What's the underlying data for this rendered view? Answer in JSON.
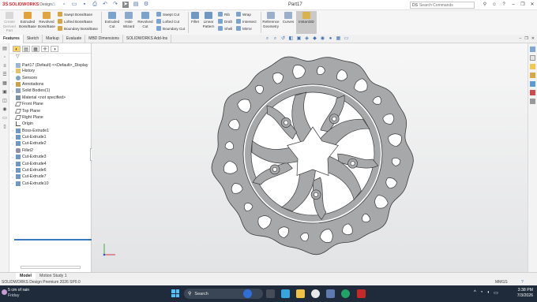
{
  "titlebar": {
    "brand_ds": "3S",
    "brand_sw": "SOLIDWORKS",
    "brand_design": "Design",
    "document": "Part17",
    "search_placeholder": "Search Commands",
    "search_brand": "DS"
  },
  "ribbon": {
    "create_derived": "Create Derived Part",
    "extruded_boss": "Extruded Boss/Base",
    "revolved_boss": "Revolved Boss/Base",
    "swept_boss": "Swept Boss/Base",
    "lofted_boss": "Lofted Boss/Base",
    "boundary_boss": "Boundary Boss/Base",
    "extruded_cut": "Extruded Cut",
    "hole_wizard": "Hole Wizard",
    "revolved_cut": "Revolved Cut",
    "swept_cut": "Swept Cut",
    "lofted_cut": "Lofted Cut",
    "boundary_cut": "Boundary Cut",
    "fillet": "Fillet",
    "linear_pattern": "Linear Pattern",
    "rib": "Rib",
    "draft": "Draft",
    "shell": "Shell",
    "wrap": "Wrap",
    "intersect": "Intersect",
    "mirror": "Mirror",
    "reference_geometry": "Reference Geometry",
    "curves": "Curves",
    "instant3d": "Instant3D"
  },
  "tabs": [
    "Features",
    "Sketch",
    "Markup",
    "Evaluate",
    "MBD Dimensions",
    "SOLIDWORKS Add-Ins"
  ],
  "tree": {
    "root": "Part17 (Default) <<Default>_Display",
    "items": [
      {
        "label": "History",
        "icon": "folder",
        "expand": true
      },
      {
        "label": "Sensors",
        "icon": "sensor",
        "expand": false
      },
      {
        "label": "Annotations",
        "icon": "anno",
        "expand": true
      },
      {
        "label": "Solid Bodies(1)",
        "icon": "solid",
        "expand": true
      },
      {
        "label": "Material <not specified>",
        "icon": "mat",
        "expand": false
      },
      {
        "label": "Front Plane",
        "icon": "plane",
        "expand": false
      },
      {
        "label": "Top Plane",
        "icon": "plane",
        "expand": false
      },
      {
        "label": "Right Plane",
        "icon": "plane",
        "expand": false
      },
      {
        "label": "Origin",
        "icon": "origin",
        "expand": false
      },
      {
        "label": "Boss-Extrude1",
        "icon": "feat",
        "expand": true
      },
      {
        "label": "Cut-Extrude1",
        "icon": "feat",
        "expand": true
      },
      {
        "label": "Cut-Extrude2",
        "icon": "feat",
        "expand": true
      },
      {
        "label": "Fillet2",
        "icon": "fillet",
        "expand": false
      },
      {
        "label": "Cut-Extrude3",
        "icon": "feat",
        "expand": true
      },
      {
        "label": "Cut-Extrude4",
        "icon": "feat",
        "expand": true
      },
      {
        "label": "Cut-Extrude6",
        "icon": "feat",
        "expand": true
      },
      {
        "label": "Cut-Extrude7",
        "icon": "feat",
        "expand": true
      },
      {
        "label": "Cut-Extrude10",
        "icon": "feat",
        "expand": true
      }
    ]
  },
  "bottom_tabs": [
    "Model",
    "Motion Study 1"
  ],
  "status": {
    "product": "SOLIDWORKS Design Premium 2026 SP0.0",
    "units": "MMGS",
    "help": "?"
  },
  "taskbar": {
    "weather_temp": "5 cm of rain",
    "weather_day": "Friday",
    "search_label": "Search",
    "time": "3:38 PM",
    "date": "7/3/2026"
  },
  "colors": {
    "part_fill": "#a7a8aa",
    "part_edge": "#3c3c3c",
    "accent": "#3b78c2",
    "brand_red": "#d4262b"
  }
}
